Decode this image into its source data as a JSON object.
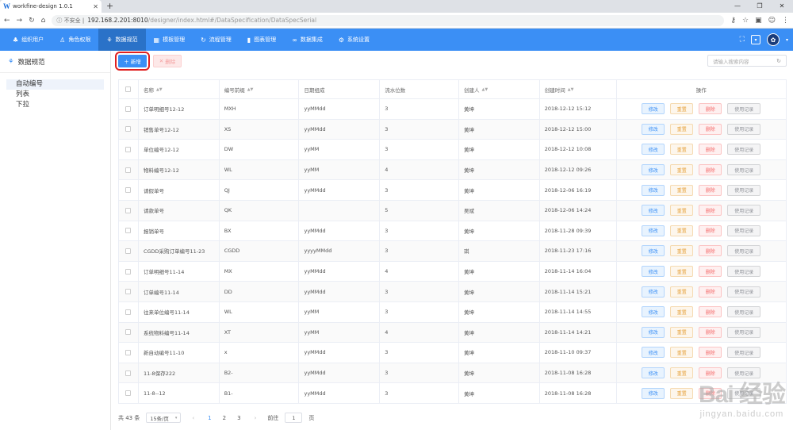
{
  "browser": {
    "tab_title": "workfine-design 1.0.1",
    "tab_logo": "W",
    "url_security": "不安全",
    "url_host": "192.168.2.201:8010",
    "url_path": "/designer/index.html#/DataSpecification/DataSpecSerial"
  },
  "nav": {
    "items": [
      {
        "label": "组织用户",
        "icon": "org-icon",
        "glyph": "♣"
      },
      {
        "label": "角色权限",
        "icon": "role-icon",
        "glyph": "♙"
      },
      {
        "label": "数据规范",
        "icon": "data-spec-icon",
        "glyph": "⚘"
      },
      {
        "label": "模板管理",
        "icon": "template-icon",
        "glyph": "▦"
      },
      {
        "label": "流程管理",
        "icon": "flow-icon",
        "glyph": "↻"
      },
      {
        "label": "图表管理",
        "icon": "chart-icon",
        "glyph": "▮"
      },
      {
        "label": "数据集成",
        "icon": "integration-icon",
        "glyph": "∞"
      },
      {
        "label": "系统设置",
        "icon": "settings-icon",
        "glyph": "⚙"
      }
    ]
  },
  "sidebar": {
    "title": "数据规范",
    "items": [
      {
        "label": "自动编号"
      },
      {
        "label": "列表"
      },
      {
        "label": "下拉"
      }
    ]
  },
  "toolbar": {
    "add_label": "新增",
    "delete_label": "删除",
    "search_placeholder": "请输入搜索内容"
  },
  "table": {
    "columns": [
      "名称",
      "编号前缀",
      "日期组成",
      "流水位数",
      "创建人",
      "创建时间",
      "操作"
    ],
    "actions": {
      "edit": "修改",
      "reset": "重置",
      "delete": "删除",
      "log": "使用记录"
    },
    "rows": [
      [
        "订单明细号12-12",
        "MXH",
        "yyMMdd",
        "3",
        "黄坤",
        "2018-12-12 15:12"
      ],
      [
        "销售单号12-12",
        "XS",
        "yyMMdd",
        "3",
        "黄坤",
        "2018-12-12 15:00"
      ],
      [
        "单位编号12-12",
        "DW",
        "yyMM",
        "3",
        "黄坤",
        "2018-12-12 10:08"
      ],
      [
        "物料编号12-12",
        "WL",
        "yyMM",
        "4",
        "黄坤",
        "2018-12-12 09:26"
      ],
      [
        "请假单号",
        "QJ",
        "yyMMdd",
        "3",
        "黄坤",
        "2018-12-06 16:19"
      ],
      [
        "请款单号",
        "QK",
        "",
        "5",
        "吴斌",
        "2018-12-06 14:24"
      ],
      [
        "报销单号",
        "BX",
        "yyMMdd",
        "3",
        "黄坤",
        "2018-11-28 09:39"
      ],
      [
        "CGDD采购订单编号11-23",
        "CGDD",
        "yyyyMMdd",
        "3",
        "琪",
        "2018-11-23 17:16"
      ],
      [
        "订单明细号11-14",
        "MX",
        "yyMMdd",
        "4",
        "黄坤",
        "2018-11-14 16:04"
      ],
      [
        "订单编号11-14",
        "DD",
        "yyMMdd",
        "3",
        "黄坤",
        "2018-11-14 15:21"
      ],
      [
        "往来单位编号11-14",
        "WL",
        "yyMM",
        "3",
        "黄坤",
        "2018-11-14 14:55"
      ],
      [
        "系统物料编号11-14",
        "XT",
        "yyMM",
        "4",
        "黄坤",
        "2018-11-14 14:21"
      ],
      [
        "新自动编号11-10",
        "x",
        "yyMMdd",
        "3",
        "黄坤",
        "2018-11-10 09:37"
      ],
      [
        "11-8保存222",
        "B2-",
        "yyMMdd",
        "3",
        "黄坤",
        "2018-11-08 16:28"
      ],
      [
        "11-8--12",
        "B1-",
        "yyMMdd",
        "3",
        "黄坤",
        "2018-11-08 16:28"
      ]
    ]
  },
  "pager": {
    "total": "共 43 条",
    "page_size": "15条/页",
    "pages": [
      "1",
      "2",
      "3"
    ],
    "goto_label": "前往",
    "goto_value": "1",
    "page_unit": "页"
  },
  "watermark": {
    "brand": "Bai 经验",
    "url": "jingyan.baidu.com"
  },
  "colors": {
    "accent": "#3b8ff5",
    "nav_active": "#2a72c8",
    "highlight_box": "#e02020"
  }
}
